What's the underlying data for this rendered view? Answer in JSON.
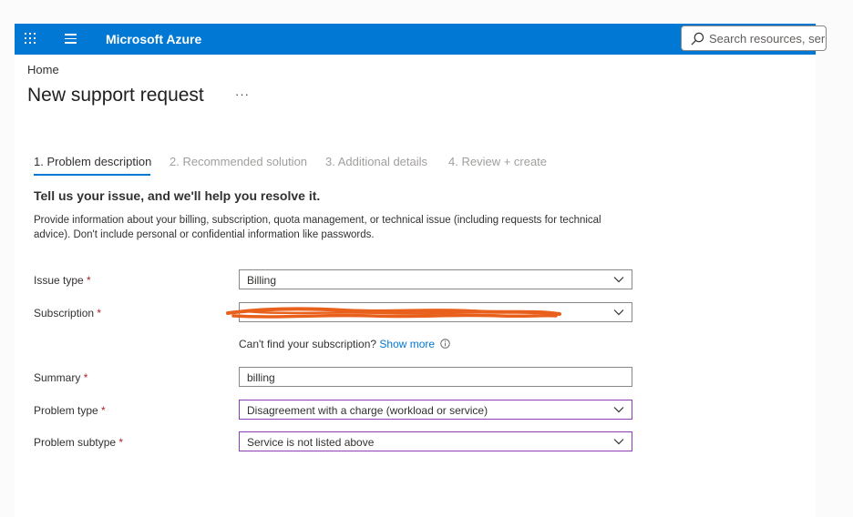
{
  "header": {
    "brand": "Microsoft Azure",
    "search_placeholder": "Search resources, ser"
  },
  "breadcrumb": "Home",
  "page": {
    "title": "New support request",
    "more": "···"
  },
  "tabs": [
    {
      "label": "1. Problem description",
      "active": true
    },
    {
      "label": "2. Recommended solution",
      "active": false
    },
    {
      "label": "3. Additional details",
      "active": false
    },
    {
      "label": "4. Review + create",
      "active": false
    }
  ],
  "section": {
    "heading": "Tell us your issue, and we'll help you resolve it.",
    "description": "Provide information about your billing, subscription, quota management, or technical issue (including requests for technical advice). Don't include personal or confidential information like passwords."
  },
  "form": {
    "issue_type": {
      "label": "Issue type",
      "required": "*",
      "value": "Billing"
    },
    "subscription": {
      "label": "Subscription",
      "required": "*",
      "value": ""
    },
    "subscription_hint": {
      "text": "Can't find your subscription?",
      "link": "Show more"
    },
    "summary": {
      "label": "Summary",
      "required": "*",
      "value": "billing"
    },
    "problem_type": {
      "label": "Problem type",
      "required": "*",
      "value": "Disagreement with a charge (workload or service)"
    },
    "problem_subtype": {
      "label": "Problem subtype",
      "required": "*",
      "value": "Service is not listed above"
    }
  },
  "colors": {
    "brand_blue": "#0078d4",
    "required_red": "#a4262c",
    "focused_border": "#8a3fb5",
    "redaction": "#e8601c"
  },
  "icons": [
    "app-launcher-icon",
    "menu-icon",
    "search-icon",
    "more-icon",
    "chevron-down-icon",
    "info-icon"
  ]
}
